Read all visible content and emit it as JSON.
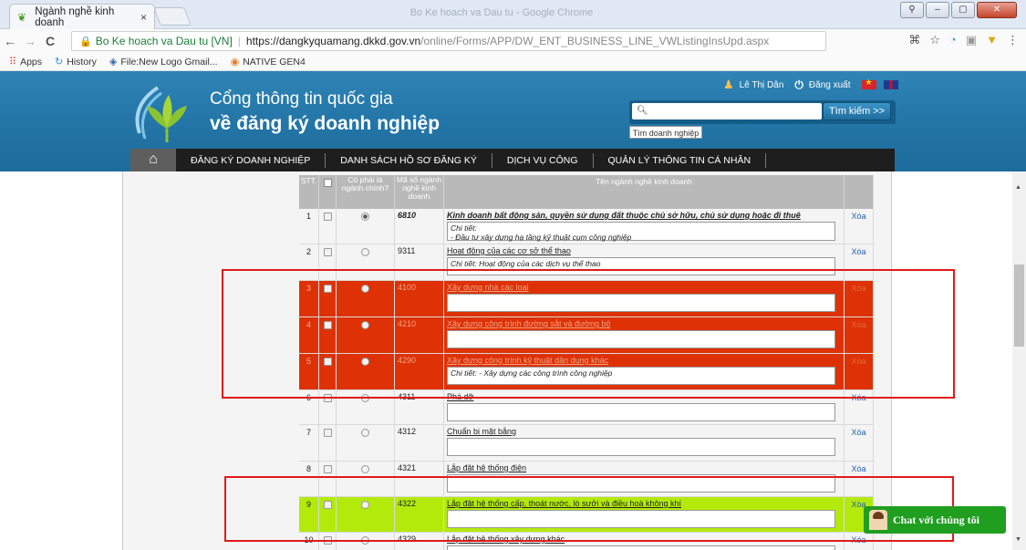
{
  "browser": {
    "tab_title": "Ngành nghề kinh doanh",
    "tab_close": "×",
    "window_title": "Bo Ke hoach va Dau tu - Google Chrome",
    "back": "←",
    "forward": "→",
    "reload": "C",
    "secure_label": "Bo Ke hoach va Dau tu [VN]",
    "url_host": "https://dangkyquamang.dkkd.gov.vn",
    "url_path": "/online/Forms/APP/DW_ENT_BUSINESS_LINE_VWListingInsUpd.aspx",
    "bookmarks": [
      "Apps",
      "History",
      "File:New Logo Gmail...",
      "NATIVE GEN4"
    ]
  },
  "header": {
    "title_line1": "Cổng thông tin quốc gia",
    "title_line2": "về đăng ký doanh nghiệp",
    "user_name": "Lê Thị Dân",
    "logout": "Đăng xuất",
    "search_placeholder": "",
    "search_button": "Tìm kiếm >>",
    "search_hint": "Tìm doanh nghiệp"
  },
  "nav": {
    "items": [
      "ĐĂNG KÝ DOANH NGHIỆP",
      "DANH SÁCH HỒ SƠ ĐĂNG KÝ",
      "DỊCH VỤ CÔNG",
      "QUẢN LÝ THÔNG TIN CÁ NHÂN"
    ]
  },
  "table": {
    "headers": {
      "stt": "STT.",
      "main": "Có phải là ngành chính?",
      "code": "Mã số ngành nghề kinh doanh",
      "name": "Tên ngành nghề kinh doanh"
    },
    "rows": [
      {
        "stt": "1",
        "code": "6810",
        "name": "Kinh doanh bất động sản, quyền sử dụng đất thuộc chủ sở hữu, chủ sử dụng hoặc đi thuê",
        "detail": "Chi tiết:\n- Đầu tư xây dựng hạ tầng kỹ thuật cụm công nghiệp",
        "action": "Xóa"
      },
      {
        "stt": "2",
        "code": "9311",
        "name": "Hoạt động của các cơ sở thể thao",
        "detail": "Chi tiết: Hoạt động của các dịch vụ thể thao",
        "action": "Xóa"
      },
      {
        "stt": "3",
        "code": "4100",
        "name": "Xây dựng nhà các loại",
        "detail": "",
        "action": "Xóa"
      },
      {
        "stt": "4",
        "code": "4210",
        "name": "Xây dựng công trình đường sắt và đường bộ",
        "detail": "",
        "action": "Xóa"
      },
      {
        "stt": "5",
        "code": "4290",
        "name": "Xây dựng công trình kỹ thuật dân dụng khác",
        "detail": "Chi tiết: - Xây dựng các công trình công nghiệp",
        "action": "Xóa"
      },
      {
        "stt": "6",
        "code": "4311",
        "name": "Phá dỡ",
        "detail": "",
        "action": "Xóa"
      },
      {
        "stt": "7",
        "code": "4312",
        "name": "Chuẩn bị mặt bằng",
        "detail": "",
        "action": "Xóa"
      },
      {
        "stt": "8",
        "code": "4321",
        "name": "Lắp đặt hệ thống điện",
        "detail": "",
        "action": "Xóa"
      },
      {
        "stt": "9",
        "code": "4322",
        "name": "Lắp đặt hệ thống cấp, thoát nước, lò sưởi và điều hoà không khí",
        "detail": "",
        "action": "Xóa"
      },
      {
        "stt": "10",
        "code": "4329",
        "name": "Lắp đặt hệ thống xây dựng khác",
        "detail": "",
        "action": "Xóa"
      }
    ]
  },
  "chat": {
    "label": "Chat với chúng tôi"
  },
  "colors": {
    "header_blue": "#2477a8",
    "highlight_red": "#de3106",
    "highlight_green": "#b3ea0c",
    "annotation": "#e01a1a"
  }
}
